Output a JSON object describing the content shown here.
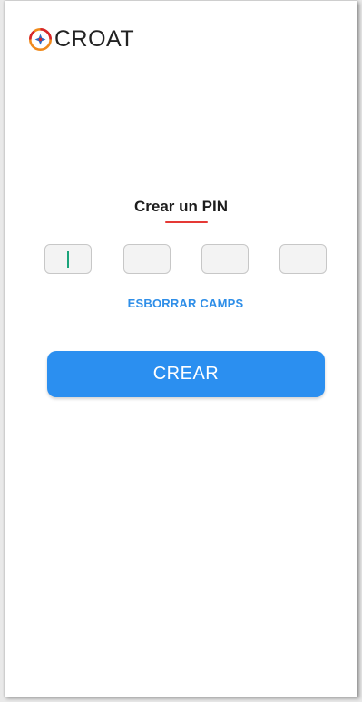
{
  "brand": {
    "name": "CROAT",
    "logo_icon": "croat-emblem-icon",
    "colors": {
      "orange": "#f08a1c",
      "red": "#d6262e",
      "blue": "#2b6bc4"
    }
  },
  "pin_screen": {
    "title": "Crear un PIN",
    "accent_color": "#e53935",
    "pin_digits": [
      "",
      "",
      "",
      ""
    ],
    "clear_label": "ESBORRAR CAMPS",
    "submit_label": "CREAR",
    "primary_color": "#2b8ff0"
  }
}
